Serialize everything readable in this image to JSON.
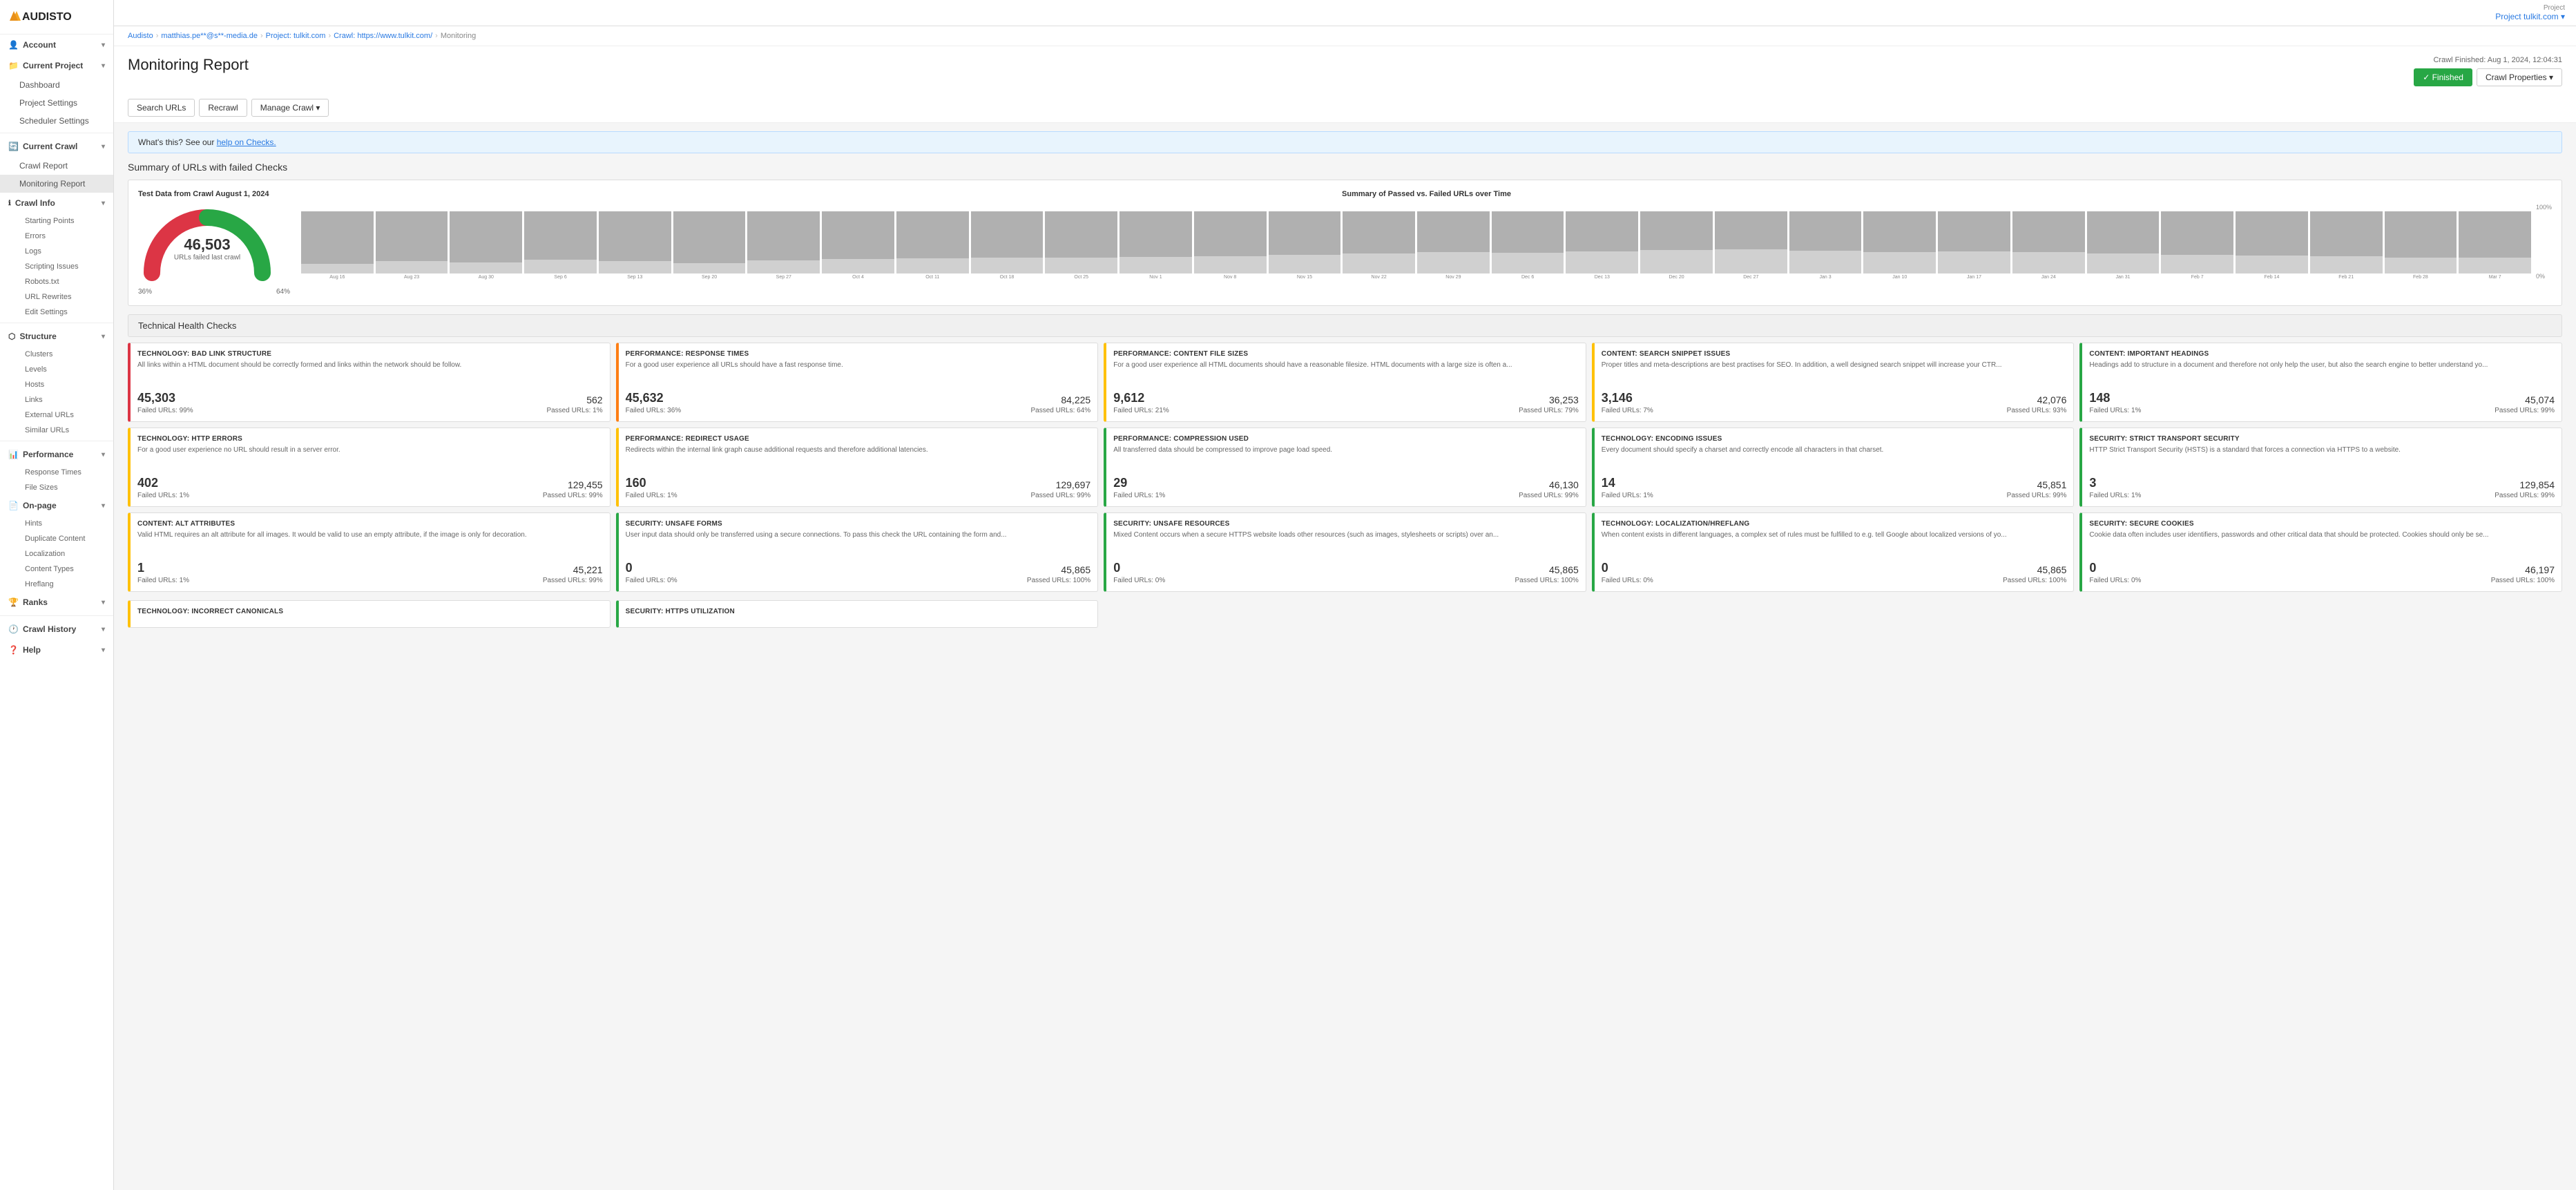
{
  "logo": {
    "text": "AUDISTO"
  },
  "topbar": {
    "project_label": "Project",
    "project_name": "Project tulkit.com ▾"
  },
  "sidebar": {
    "account": {
      "label": "Account",
      "arrow": "▾"
    },
    "current_project": {
      "label": "Current Project",
      "arrow": "▾"
    },
    "project_items": [
      "Dashboard",
      "Project Settings",
      "Scheduler Settings"
    ],
    "current_crawl": {
      "label": "Current Crawl",
      "arrow": "▾"
    },
    "crawl_items": [
      "Crawl Report",
      "Monitoring Report"
    ],
    "crawl_info": {
      "label": "Crawl Info",
      "arrow": "▾"
    },
    "crawl_info_items": [
      "Starting Points",
      "Errors",
      "Logs",
      "Scripting Issues",
      "Robots.txt",
      "URL Rewrites",
      "Edit Settings"
    ],
    "structure": {
      "label": "Structure",
      "arrow": "▾"
    },
    "structure_items": [
      "Clusters",
      "Levels",
      "Hosts",
      "Links",
      "External URLs",
      "Similar URLs"
    ],
    "performance": {
      "label": "Performance",
      "arrow": "▾"
    },
    "performance_items": [
      "Response Times",
      "File Sizes"
    ],
    "on_page": {
      "label": "On-page",
      "arrow": "▾"
    },
    "on_page_items": [
      "Hints",
      "Duplicate Content",
      "Localization",
      "Content Types",
      "Hreflang"
    ],
    "ranks": {
      "label": "Ranks",
      "arrow": "▾"
    },
    "crawl_history": {
      "label": "Crawl History",
      "arrow": "▾"
    },
    "help": {
      "label": "Help",
      "arrow": "▾"
    }
  },
  "breadcrumb": {
    "items": [
      "Audisto",
      "matthias.pe**@s**-media.de",
      "Project: tulkit.com",
      "Crawl: https://www.tulkit.com/",
      "Monitoring"
    ]
  },
  "page": {
    "title": "Monitoring Report",
    "crawl_finished": "Crawl Finished: Aug 1, 2024, 12:04:31",
    "status_label": "✓ Finished",
    "crawl_properties": "Crawl Properties ▾"
  },
  "toolbar": {
    "search_urls": "Search URLs",
    "recrawl": "Recrawl",
    "manage_crawl": "Manage Crawl ▾"
  },
  "info_bar": {
    "text": "What's this? See our ",
    "link_text": "help on Checks.",
    "link_href": "#"
  },
  "summary_section": {
    "title": "Summary of URLs with failed Checks",
    "gauge": {
      "chart_title": "Test Data from Crawl August 1, 2024",
      "number": "46,503",
      "label": "URLs failed last crawl",
      "pct_left": "36%",
      "pct_right": "64%"
    },
    "bar_chart": {
      "title": "Summary of Passed vs. Failed URLs over Time",
      "y_labels": [
        "100%",
        "0%"
      ],
      "bars": [
        {
          "label": "Aug 16",
          "passed": 85,
          "failed": 15
        },
        {
          "label": "Aug 23",
          "passed": 80,
          "failed": 20
        },
        {
          "label": "Aug 30",
          "passed": 82,
          "failed": 18
        },
        {
          "label": "Sep 6",
          "passed": 78,
          "failed": 22
        },
        {
          "label": "Sep 13",
          "passed": 80,
          "failed": 20
        },
        {
          "label": "Sep 20",
          "passed": 83,
          "failed": 17
        },
        {
          "label": "Sep 27",
          "passed": 79,
          "failed": 21
        },
        {
          "label": "Oct 4",
          "passed": 77,
          "failed": 23
        },
        {
          "label": "Oct 11",
          "passed": 76,
          "failed": 24
        },
        {
          "label": "Oct 18",
          "passed": 75,
          "failed": 25
        },
        {
          "label": "Oct 25",
          "passed": 74,
          "failed": 26
        },
        {
          "label": "Nov 1",
          "passed": 73,
          "failed": 27
        },
        {
          "label": "Nov 8",
          "passed": 72,
          "failed": 28
        },
        {
          "label": "Nov 15",
          "passed": 70,
          "failed": 30
        },
        {
          "label": "Nov 22",
          "passed": 68,
          "failed": 32
        },
        {
          "label": "Nov 29",
          "passed": 65,
          "failed": 35
        },
        {
          "label": "Dec 6",
          "passed": 67,
          "failed": 33
        },
        {
          "label": "Dec 13",
          "passed": 64,
          "failed": 36
        },
        {
          "label": "Dec 20",
          "passed": 62,
          "failed": 38
        },
        {
          "label": "Dec 27",
          "passed": 61,
          "failed": 39
        },
        {
          "label": "Jan 3",
          "passed": 63,
          "failed": 37
        },
        {
          "label": "Jan 10",
          "passed": 65,
          "failed": 35
        },
        {
          "label": "Jan 17",
          "passed": 64,
          "failed": 36
        },
        {
          "label": "Jan 24",
          "passed": 66,
          "failed": 34
        },
        {
          "label": "Jan 31",
          "passed": 68,
          "failed": 32
        },
        {
          "label": "Feb 7",
          "passed": 70,
          "failed": 30
        },
        {
          "label": "Feb 14",
          "passed": 71,
          "failed": 29
        },
        {
          "label": "Feb 21",
          "passed": 72,
          "failed": 28
        },
        {
          "label": "Feb 28",
          "passed": 74,
          "failed": 26
        },
        {
          "label": "Mar 7",
          "passed": 75,
          "failed": 25
        }
      ]
    }
  },
  "tech_health": {
    "section_title": "Technical Health Checks",
    "cards": [
      {
        "title": "TECHNOLOGY: Bad Link Structure",
        "desc": "All links within a HTML document should be correctly formed and links within the network should be follow.",
        "failed": "45,303",
        "passed": "562",
        "failed_pct": "Failed URLs: 99%",
        "passed_pct": "Passed URLs: 1%",
        "color": "red"
      },
      {
        "title": "PERFORMANCE: Response Times",
        "desc": "For a good user experience all URLs should have a fast response time.",
        "failed": "45,632",
        "passed": "84,225",
        "failed_pct": "Failed URLs: 36%",
        "passed_pct": "Passed URLs: 64%",
        "color": "orange"
      },
      {
        "title": "PERFORMANCE: Content File Sizes",
        "desc": "For a good user experience all HTML documents should have a reasonable filesize. HTML documents with a large size is often a...",
        "failed": "9,612",
        "passed": "36,253",
        "failed_pct": "Failed URLs: 21%",
        "passed_pct": "Passed URLs: 79%",
        "color": "yellow"
      },
      {
        "title": "CONTENT: Search Snippet Issues",
        "desc": "Proper titles and meta-descriptions are best practises for SEO. In addition, a well designed search snippet will increase your CTR...",
        "failed": "3,146",
        "passed": "42,076",
        "failed_pct": "Failed URLs: 7%",
        "passed_pct": "Passed URLs: 93%",
        "color": "yellow"
      },
      {
        "title": "CONTENT: Important Headings",
        "desc": "Headings add to structure in a document and therefore not only help the user, but also the search engine to better understand yo...",
        "failed": "148",
        "passed": "45,074",
        "failed_pct": "Failed URLs: 1%",
        "passed_pct": "Passed URLs: 99%",
        "color": "green"
      },
      {
        "title": "TECHNOLOGY: HTTP Errors",
        "desc": "For a good user experience no URL should result in a server error.",
        "failed": "402",
        "passed": "129,455",
        "failed_pct": "Failed URLs: 1%",
        "passed_pct": "Passed URLs: 99%",
        "color": "yellow"
      },
      {
        "title": "PERFORMANCE: Redirect Usage",
        "desc": "Redirects within the internal link graph cause additional requests and therefore additional latencies.",
        "failed": "160",
        "passed": "129,697",
        "failed_pct": "Failed URLs: 1%",
        "passed_pct": "Passed URLs: 99%",
        "color": "yellow"
      },
      {
        "title": "PERFORMANCE: Compression Used",
        "desc": "All transferred data should be compressed to improve page load speed.",
        "failed": "29",
        "passed": "46,130",
        "failed_pct": "Failed URLs: 1%",
        "passed_pct": "Passed URLs: 99%",
        "color": "green"
      },
      {
        "title": "TECHNOLOGY: Encoding Issues",
        "desc": "Every document should specify a charset and correctly encode all characters in that charset.",
        "failed": "14",
        "passed": "45,851",
        "failed_pct": "Failed URLs: 1%",
        "passed_pct": "Passed URLs: 99%",
        "color": "green"
      },
      {
        "title": "SECURITY: Strict Transport Security",
        "desc": "HTTP Strict Transport Security (HSTS) is a standard that forces a connection via HTTPS to a website.",
        "failed": "3",
        "passed": "129,854",
        "failed_pct": "Failed URLs: 1%",
        "passed_pct": "Passed URLs: 99%",
        "color": "green"
      },
      {
        "title": "CONTENT: Alt Attributes",
        "desc": "Valid HTML requires an alt attribute for all images. It would be valid to use an empty attribute, if the image is only for decoration.",
        "failed": "1",
        "passed": "45,221",
        "failed_pct": "Failed URLs: 1%",
        "passed_pct": "Passed URLs: 99%",
        "color": "yellow"
      },
      {
        "title": "SECURITY: Unsafe Forms",
        "desc": "User input data should only be transferred using a secure connections. To pass this check the URL containing the form and...",
        "failed": "0",
        "passed": "45,865",
        "failed_pct": "Failed URLs: 0%",
        "passed_pct": "Passed URLs: 100%",
        "color": "green"
      },
      {
        "title": "SECURITY: Unsafe Resources",
        "desc": "Mixed Content occurs when a secure HTTPS website loads other resources (such as images, stylesheets or scripts) over an...",
        "failed": "0",
        "passed": "45,865",
        "failed_pct": "Failed URLs: 0%",
        "passed_pct": "Passed URLs: 100%",
        "color": "green"
      },
      {
        "title": "TECHNOLOGY: Localization/Hreflang",
        "desc": "When content exists in different languages, a complex set of rules must be fulfilled to e.g. tell Google about localized versions of yo...",
        "failed": "0",
        "passed": "45,865",
        "failed_pct": "Failed URLs: 0%",
        "passed_pct": "Passed URLs: 100%",
        "color": "green"
      },
      {
        "title": "SECURITY: Secure Cookies",
        "desc": "Cookie data often includes user identifiers, passwords and other critical data that should be protected. Cookies should only be se...",
        "failed": "0",
        "passed": "46,197",
        "failed_pct": "Failed URLs: 0%",
        "passed_pct": "Passed URLs: 100%",
        "color": "green"
      }
    ],
    "bottom_cards": [
      {
        "title": "TECHNOLOGY: Incorrect Canonicals",
        "color": "yellow"
      },
      {
        "title": "SECURITY: HTTPS Utilization",
        "color": "green"
      }
    ]
  }
}
